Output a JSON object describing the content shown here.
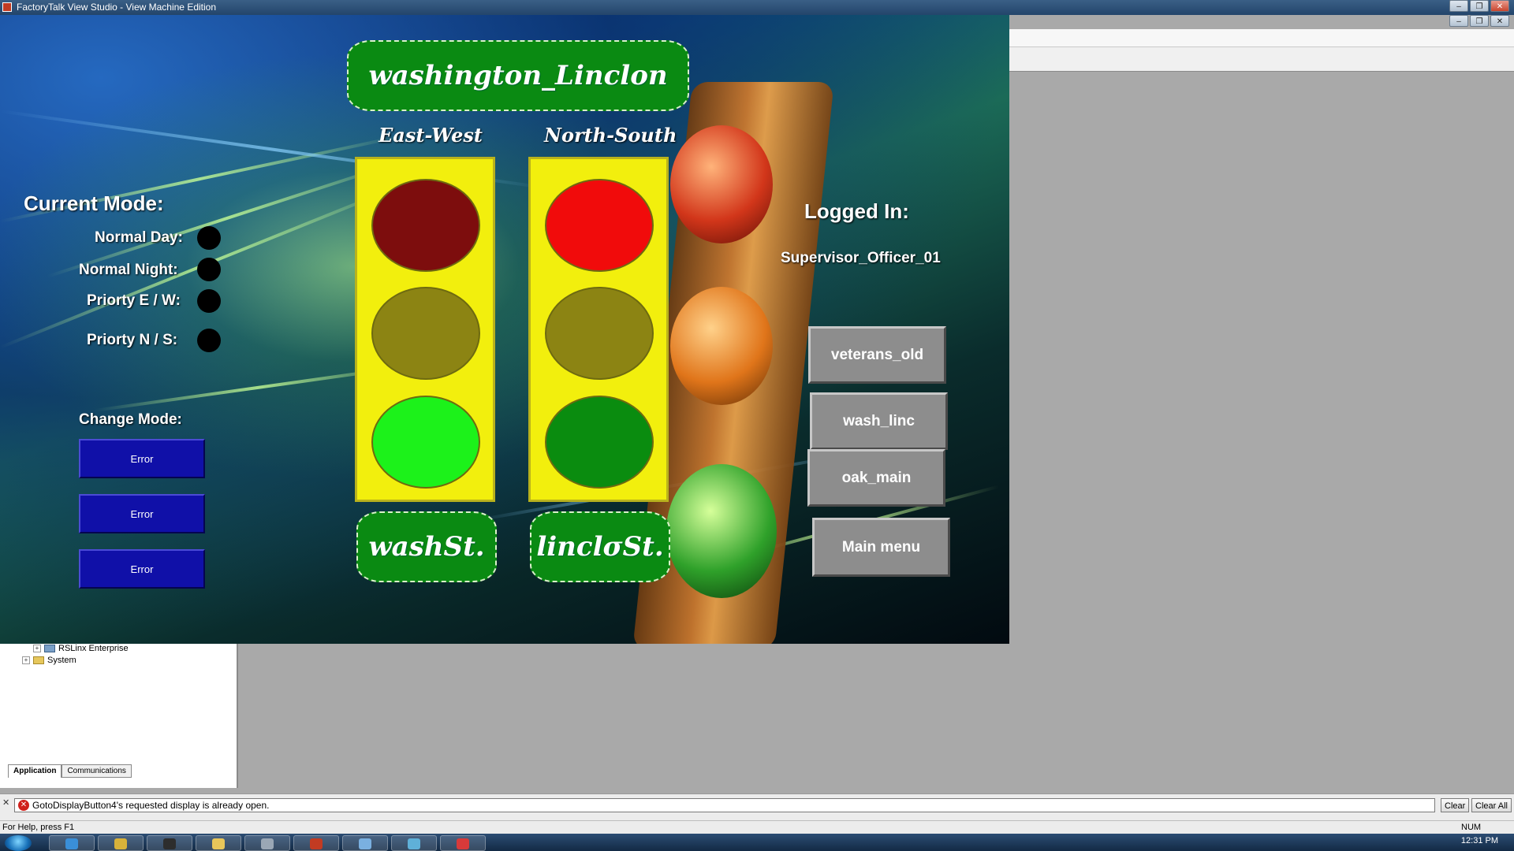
{
  "window": {
    "title": "FactoryTalk View Studio - View Machine Edition"
  },
  "hmi": {
    "header": "washington_Linclon",
    "direction_ew": "East-West",
    "direction_ns": "North-South",
    "current_mode_title": "Current Mode:",
    "modes": [
      {
        "label": "Normal Day:"
      },
      {
        "label": "Normal Night:"
      },
      {
        "label": "Priorty E / W:"
      },
      {
        "label": "Priorty N / S:"
      }
    ],
    "change_mode_title": "Change Mode:",
    "change_buttons": [
      "Error",
      "Error",
      "Error"
    ],
    "street_ew": "washSt.",
    "street_ns": "linclσSt.",
    "logged_in_title": "Logged In:",
    "user": "Supervisor_Officer_01",
    "nav_buttons": [
      "veterans_old",
      "wash_linc",
      "oak_main",
      "Main menu"
    ],
    "lights": {
      "ew": {
        "red": "#7d0d0d",
        "yellow": "#8c8413",
        "green": "#1cf21a",
        "active": "green"
      },
      "ns": {
        "red": "#f10b0b",
        "yellow": "#8c8413",
        "green": "#0a8c0f",
        "active": "red"
      }
    }
  },
  "tree": {
    "items": [
      "RSLinx Enterprise",
      "System"
    ],
    "tabs": [
      "Application",
      "Communications"
    ]
  },
  "diagnostics": {
    "message": "GotoDisplayButton4's requested display is already open.",
    "clear_label": "Clear",
    "clear_all_label": "Clear All"
  },
  "statusbar": {
    "help": "For Help, press F1",
    "num": "NUM"
  },
  "taskbar": {
    "clock": "12:31 PM"
  }
}
